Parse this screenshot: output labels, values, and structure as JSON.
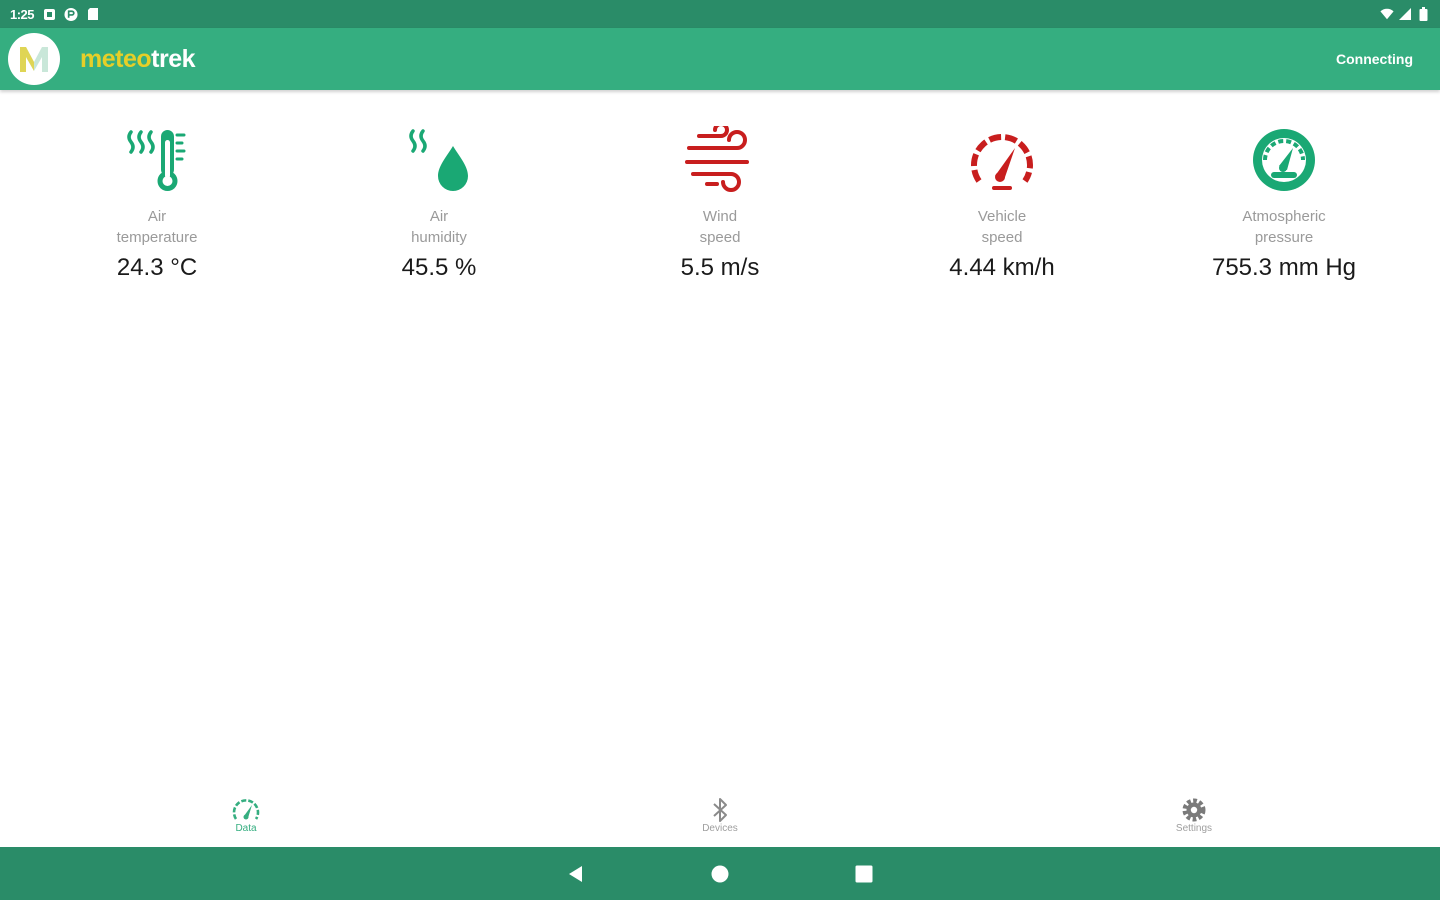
{
  "status_bar": {
    "time": "1:25",
    "icons": [
      "notification-icon",
      "p-icon",
      "sd-card-icon",
      "wifi-icon",
      "signal-icon",
      "battery-icon"
    ]
  },
  "app_bar": {
    "logo_letter": "M",
    "title_part_1": "meteo",
    "title_part_2": "trek",
    "connection_status": "Connecting"
  },
  "sensors": [
    {
      "label": "Air\ntemperature",
      "value": "24.3 °C",
      "icon": "thermometer-heat-icon",
      "color": "#1aa874"
    },
    {
      "label": "Air\nhumidity",
      "value": "45.5 %",
      "icon": "humidity-drop-icon",
      "color": "#1aa874"
    },
    {
      "label": "Wind\nspeed",
      "value": "5.5 m/s",
      "icon": "wind-icon",
      "color": "#c81e1e"
    },
    {
      "label": "Vehicle\nspeed",
      "value": "4.44 km/h",
      "icon": "speedometer-icon",
      "color": "#c81e1e"
    },
    {
      "label": "Atmospheric\npressure",
      "value": "755.3 mm Hg",
      "icon": "barometer-icon",
      "color": "#1aa874"
    }
  ],
  "bottom_nav": {
    "items": [
      {
        "label": "Data",
        "icon": "gauge-icon",
        "active": true
      },
      {
        "label": "Devices",
        "icon": "bluetooth-icon",
        "active": false
      },
      {
        "label": "Settings",
        "icon": "gear-icon",
        "active": false
      }
    ]
  },
  "system_nav": {
    "buttons": [
      "back-icon",
      "home-icon",
      "recents-icon"
    ]
  },
  "colors": {
    "primary": "#35ae80",
    "primary_dark": "#2a8c68",
    "accent_yellow": "#e6cf28",
    "sensor_green": "#1aa874",
    "sensor_red": "#c81e1e"
  }
}
